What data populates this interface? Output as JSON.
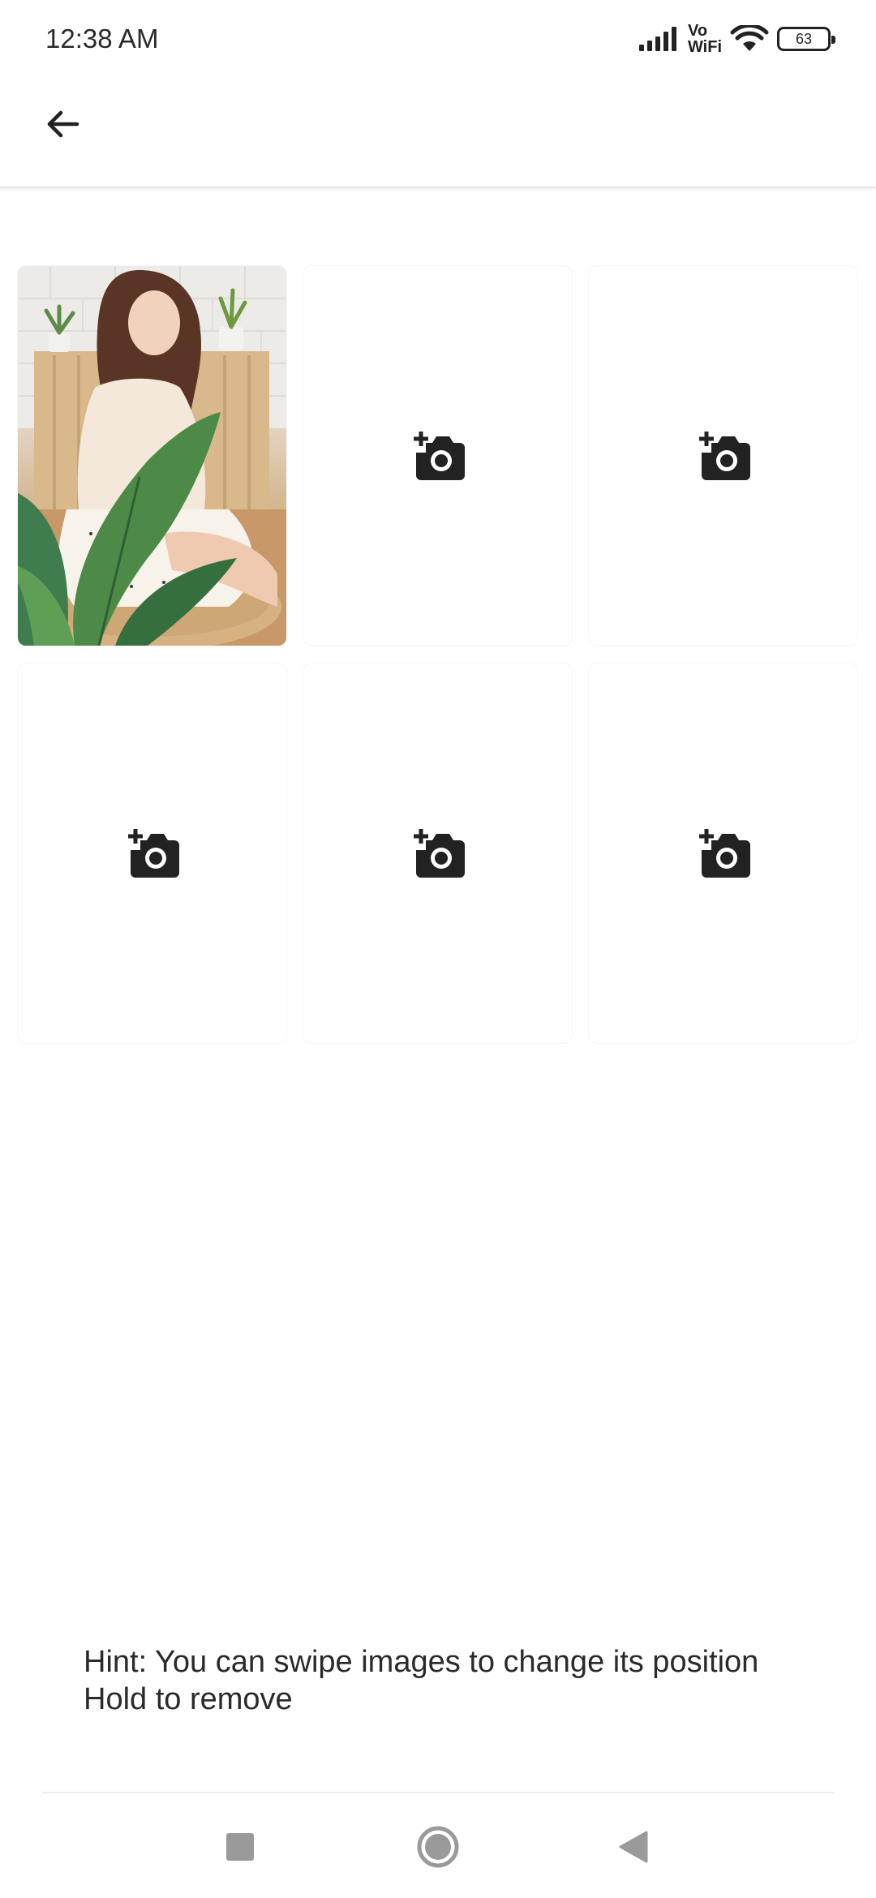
{
  "status_bar": {
    "time": "12:38 AM",
    "vo": "Vo",
    "wifi_label": "WiFi",
    "battery": "63",
    "icons": [
      "signal-icon",
      "vowifi-icon",
      "wifi-icon",
      "battery-icon"
    ]
  },
  "app_bar": {
    "back_icon": "arrow-left-icon"
  },
  "photo_grid": {
    "slots": [
      {
        "kind": "photo",
        "description": "profile-photo"
      },
      {
        "kind": "empty",
        "icon": "add-photo-icon"
      },
      {
        "kind": "empty",
        "icon": "add-photo-icon"
      },
      {
        "kind": "empty",
        "icon": "add-photo-icon"
      },
      {
        "kind": "empty",
        "icon": "add-photo-icon"
      },
      {
        "kind": "empty",
        "icon": "add-photo-icon"
      }
    ]
  },
  "hint": {
    "line1": "Hint: You can swipe images to change its position",
    "line2": "Hold to remove"
  },
  "nav_bar": {
    "icons": [
      "recents-square-icon",
      "home-circle-icon",
      "back-triangle-icon"
    ]
  },
  "colors": {
    "icon_dark": "#222222",
    "text": "#2a2a2a",
    "background": "#ffffff"
  }
}
